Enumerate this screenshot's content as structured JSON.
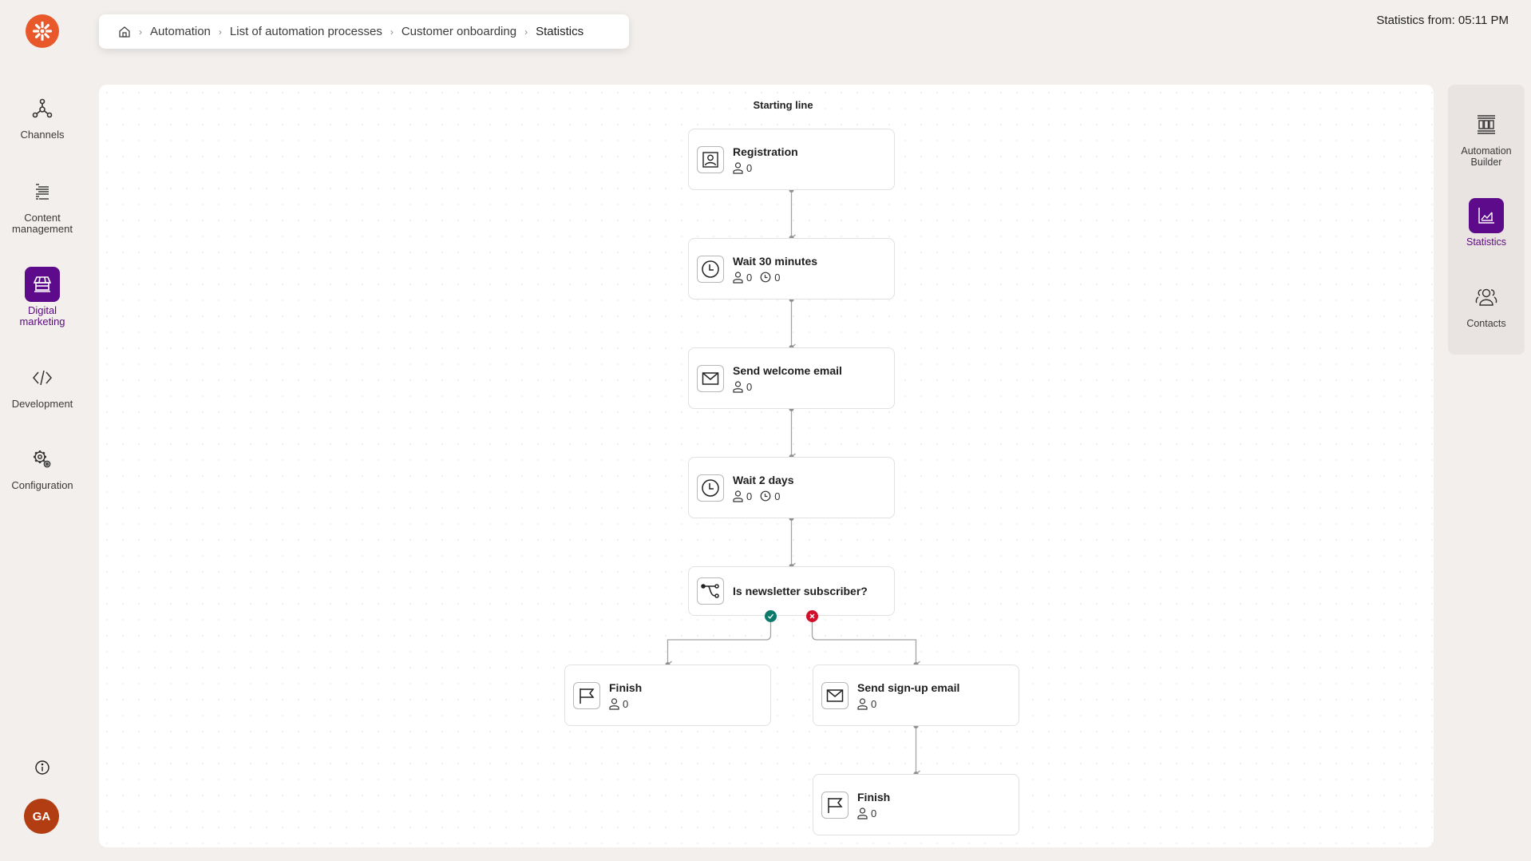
{
  "app": {
    "logo_icon": "kentico-asterisk-icon",
    "brand_color": "#e8582a",
    "accent_color": "#5e0b8b"
  },
  "sidebar": {
    "items": [
      {
        "label": "Channels",
        "icon": "channels-icon",
        "active": false
      },
      {
        "label": "Content management",
        "icon": "content-list-icon",
        "active": false
      },
      {
        "label": "Digital marketing",
        "icon": "store-icon",
        "active": true
      },
      {
        "label": "Development",
        "icon": "code-icon",
        "active": false
      },
      {
        "label": "Configuration",
        "icon": "gears-icon",
        "active": false
      }
    ],
    "info_icon": "info-icon",
    "avatar_initials": "GA"
  },
  "breadcrumb": {
    "home_icon": "home-icon",
    "items": [
      "Automation",
      "List of automation processes",
      "Customer onboarding",
      "Statistics"
    ]
  },
  "header": {
    "stats_from": "Statistics from: 05:11 PM"
  },
  "canvas": {
    "starting_line": "Starting line",
    "nodes": [
      {
        "id": "registration",
        "title": "Registration",
        "icon": "contact-card-icon",
        "contacts": "0"
      },
      {
        "id": "wait30",
        "title": "Wait 30 minutes",
        "icon": "clock-icon",
        "contacts": "0",
        "waiting": "0"
      },
      {
        "id": "welcome",
        "title": "Send welcome email",
        "icon": "envelope-icon",
        "contacts": "0"
      },
      {
        "id": "wait2",
        "title": "Wait 2 days",
        "icon": "clock-icon",
        "contacts": "0",
        "waiting": "0"
      },
      {
        "id": "decision",
        "title": "Is newsletter subscriber?",
        "icon": "branch-icon"
      },
      {
        "id": "finish1",
        "title": "Finish",
        "icon": "flag-icon",
        "contacts": "0"
      },
      {
        "id": "signup",
        "title": "Send sign-up email",
        "icon": "envelope-icon",
        "contacts": "0"
      },
      {
        "id": "finish2",
        "title": "Finish",
        "icon": "flag-icon",
        "contacts": "0"
      }
    ],
    "branch_colors": {
      "yes": "#0b7a6a",
      "no": "#d0102b"
    }
  },
  "right_panel": {
    "items": [
      {
        "label": "Automation Builder",
        "icon": "builder-icon",
        "active": false
      },
      {
        "label": "Statistics",
        "icon": "chart-icon",
        "active": true
      },
      {
        "label": "Contacts",
        "icon": "contacts-icon",
        "active": false
      }
    ]
  }
}
